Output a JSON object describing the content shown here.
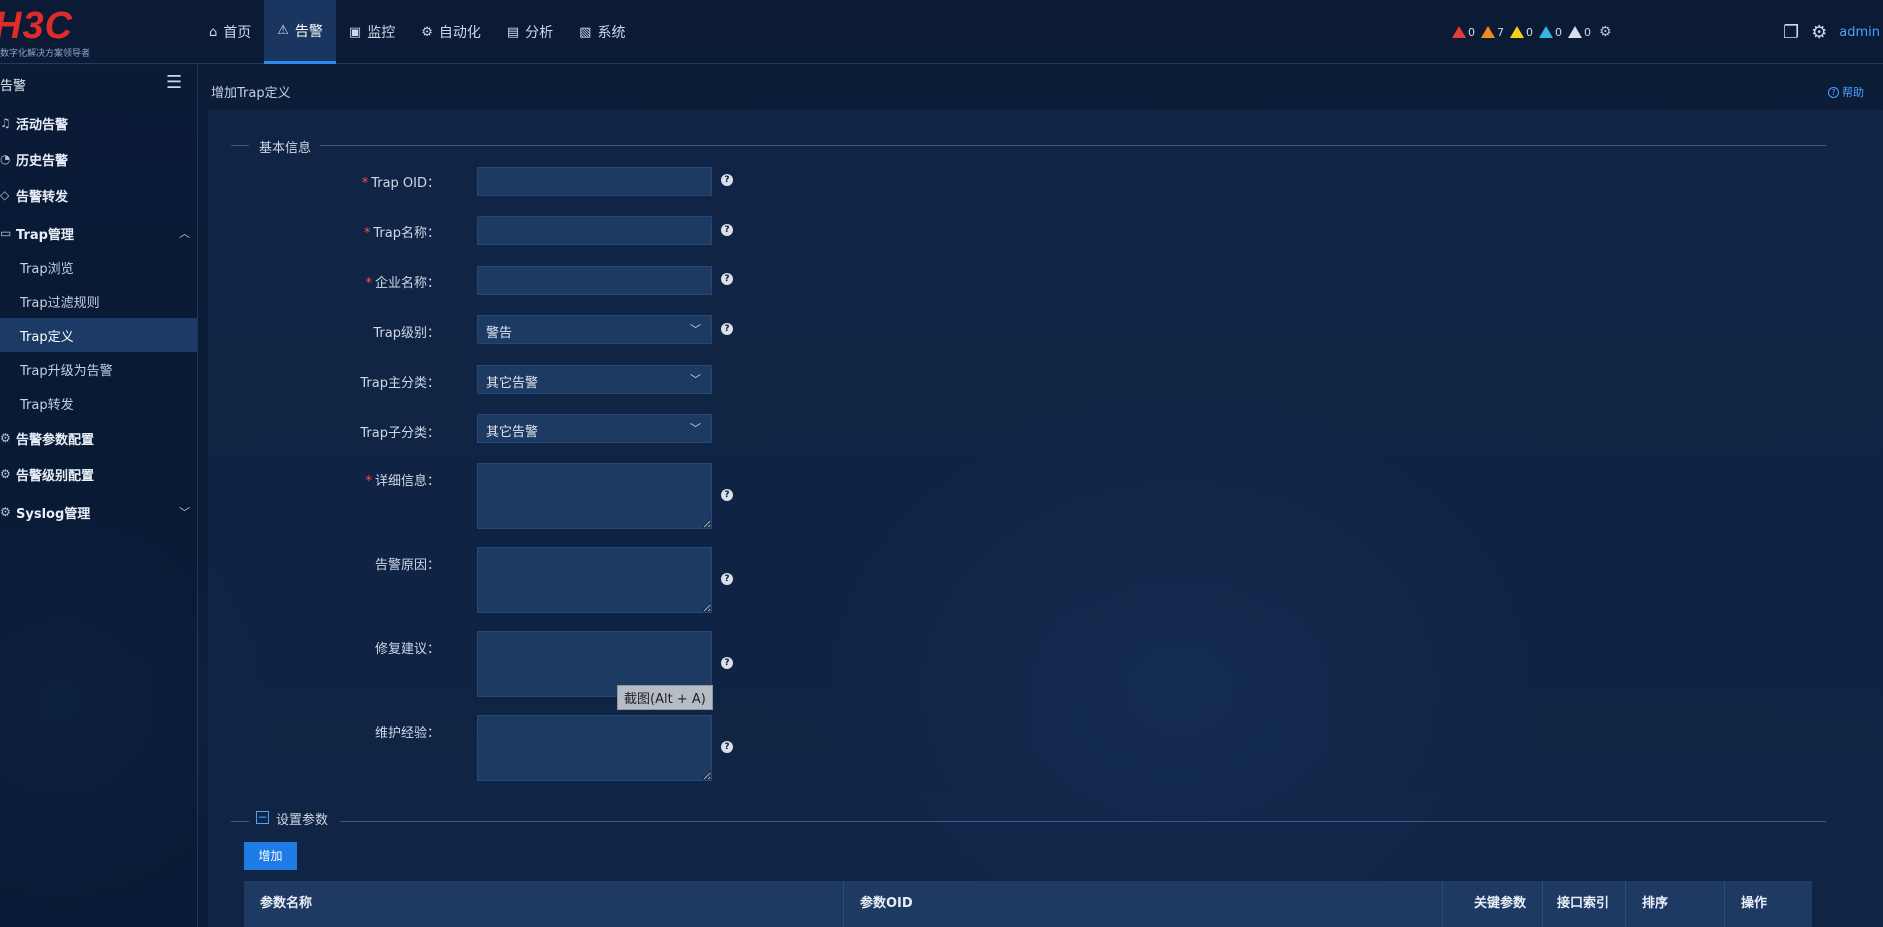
{
  "brand": {
    "logo_text": "H3C",
    "slogan": "数字化解决方案领导者"
  },
  "nav": {
    "items": [
      {
        "label": "首页",
        "icon": "home-icon",
        "glyph": "⌂"
      },
      {
        "label": "告警",
        "icon": "warning-icon",
        "glyph": "⚠"
      },
      {
        "label": "监控",
        "icon": "monitor-icon",
        "glyph": "▣"
      },
      {
        "label": "自动化",
        "icon": "automation-icon",
        "glyph": "⚙"
      },
      {
        "label": "分析",
        "icon": "analysis-icon",
        "glyph": "▤"
      },
      {
        "label": "系统",
        "icon": "system-icon",
        "glyph": "▧"
      }
    ],
    "active": "告警"
  },
  "alarm_counts": [
    {
      "level": "critical",
      "count": "0",
      "color": "#e23b3b"
    },
    {
      "level": "major",
      "count": "7",
      "color": "#f08a24"
    },
    {
      "level": "minor",
      "count": "0",
      "color": "#f2d21b"
    },
    {
      "level": "warning",
      "count": "0",
      "color": "#37b4e8"
    },
    {
      "level": "info",
      "count": "0",
      "color": "#d9dee6"
    }
  ],
  "user": {
    "name": "admin"
  },
  "sidebar": {
    "title": "告警",
    "items": [
      {
        "label": "活动告警"
      },
      {
        "label": "历史告警"
      },
      {
        "label": "告警转发"
      },
      {
        "label": "Trap管理",
        "expanded": true
      },
      {
        "label": "告警参数配置"
      },
      {
        "label": "告警级别配置"
      },
      {
        "label": "Syslog管理",
        "expanded": false
      }
    ],
    "trap_subitems": [
      {
        "label": "Trap浏览"
      },
      {
        "label": "Trap过滤规则"
      },
      {
        "label": "Trap定义",
        "active": true
      },
      {
        "label": "Trap升级为告警"
      },
      {
        "label": "Trap转发"
      }
    ]
  },
  "page": {
    "breadcrumb": "增加Trap定义",
    "help_label": "帮助"
  },
  "basic_info": {
    "title": "基本信息",
    "fields": {
      "oid": {
        "label": "Trap OID：",
        "required": true,
        "value": ""
      },
      "name": {
        "label": "Trap名称：",
        "required": true,
        "value": ""
      },
      "vendor": {
        "label": "企业名称：",
        "required": true,
        "value": ""
      },
      "level": {
        "label": "Trap级别：",
        "value": "警告"
      },
      "main_category": {
        "label": "Trap主分类：",
        "value": "其它告警"
      },
      "sub_category": {
        "label": "Trap子分类：",
        "value": "其它告警"
      },
      "detail": {
        "label": "详细信息：",
        "required": true,
        "value": ""
      },
      "cause": {
        "label": "告警原因：",
        "value": ""
      },
      "repair": {
        "label": "修复建议：",
        "value": ""
      },
      "experience": {
        "label": "维护经验：",
        "value": ""
      }
    },
    "required_mark": "*",
    "help_glyph": "?"
  },
  "tooltip": "截图(Alt + A)",
  "params": {
    "title": "设置参数",
    "add_label": "增加",
    "columns": [
      "参数名称",
      "参数OID",
      "关键参数",
      "接口索引",
      "排序",
      "操作"
    ]
  }
}
